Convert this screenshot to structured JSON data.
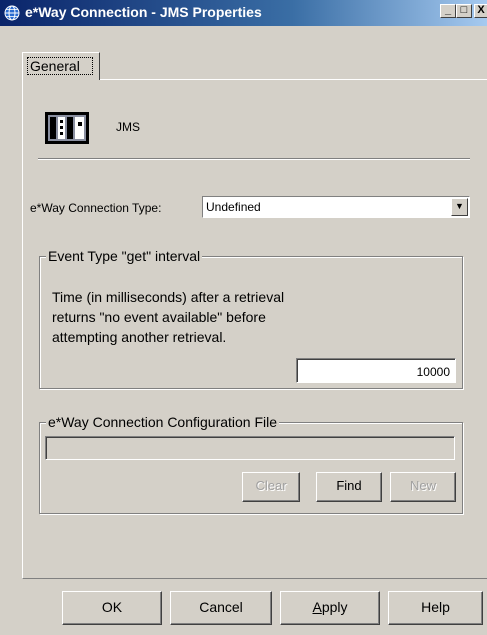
{
  "window": {
    "title": "e*Way Connection - JMS Properties",
    "controls": {
      "minimize": "_",
      "maximize": "□",
      "close": "X"
    }
  },
  "tabs": [
    {
      "label": "General",
      "active": true
    }
  ],
  "component": {
    "icon": "jms-connector-icon",
    "label": "JMS"
  },
  "connection_type": {
    "label": "e*Way Connection Type:",
    "value": "Undefined"
  },
  "event_interval": {
    "legend": "Event Type \"get\" interval",
    "description": "Time (in milliseconds) after a retrieval\nreturns \"no event available\" before\nattempting another retrieval.",
    "value": "10000"
  },
  "config_file": {
    "legend": "e*Way Connection Configuration File",
    "value": "",
    "buttons": {
      "clear": "Clear",
      "find": "Find",
      "new": "New"
    }
  },
  "footer": {
    "ok": "OK",
    "cancel": "Cancel",
    "apply_first": "A",
    "apply_rest": "pply",
    "help": "Help"
  },
  "colors": {
    "face": "#d4d0c8",
    "title_start": "#0a246a",
    "title_end": "#a6caf0"
  }
}
